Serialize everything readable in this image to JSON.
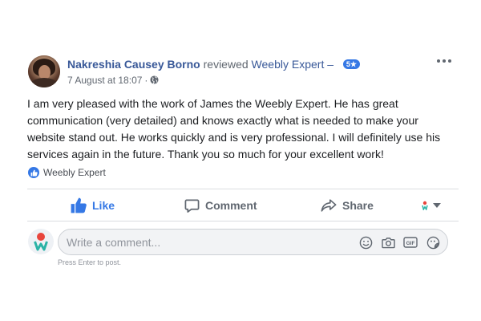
{
  "post": {
    "author": "Nakreshia Causey Borno",
    "action_text": "reviewed",
    "page_name": "Weebly Expert",
    "dash": "–",
    "rating": "5",
    "timestamp": "7 August at 18:07",
    "separator": "·",
    "privacy_icon": "globe-icon",
    "body": "I am very pleased with the work of James the Weebly Expert. He has great communication (very detailed) and knows exactly what is needed to make your website stand out. He works quickly and is very professional. I will definitely use his services again in the future. Thank you so much for your excellent work!",
    "tagged_page": "Weebly Expert"
  },
  "actions": {
    "like": "Like",
    "comment": "Comment",
    "share": "Share"
  },
  "composer": {
    "placeholder": "Write a comment...",
    "hint": "Press Enter to post.",
    "icons": [
      "emoji-icon",
      "camera-icon",
      "gif-icon",
      "sticker-icon"
    ]
  },
  "colors": {
    "link": "#385898",
    "accent": "#3578e5",
    "muted": "#606770",
    "text": "#1c1e21"
  }
}
